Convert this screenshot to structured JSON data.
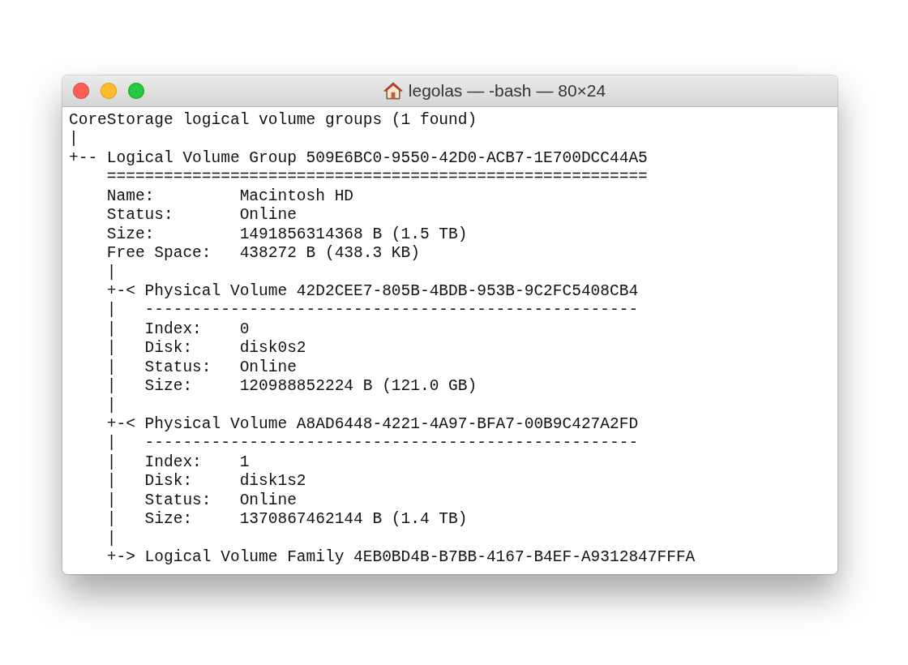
{
  "window": {
    "title": "legolas — -bash — 80×24"
  },
  "terminal": {
    "lines": [
      "CoreStorage logical volume groups (1 found)",
      "|",
      "+-- Logical Volume Group 509E6BC0-9550-42D0-ACB7-1E700DCC44A5",
      "    =========================================================",
      "    Name:         Macintosh HD",
      "    Status:       Online",
      "    Size:         1491856314368 B (1.5 TB)",
      "    Free Space:   438272 B (438.3 KB)",
      "    |",
      "    +-< Physical Volume 42D2CEE7-805B-4BDB-953B-9C2FC5408CB4",
      "    |   ----------------------------------------------------",
      "    |   Index:    0",
      "    |   Disk:     disk0s2",
      "    |   Status:   Online",
      "    |   Size:     120988852224 B (121.0 GB)",
      "    |",
      "    +-< Physical Volume A8AD6448-4221-4A97-BFA7-00B9C427A2FD",
      "    |   ----------------------------------------------------",
      "    |   Index:    1",
      "    |   Disk:     disk1s2",
      "    |   Status:   Online",
      "    |   Size:     1370867462144 B (1.4 TB)",
      "    |",
      "    +-> Logical Volume Family 4EB0BD4B-B7BB-4167-B4EF-A9312847FFFA"
    ]
  }
}
